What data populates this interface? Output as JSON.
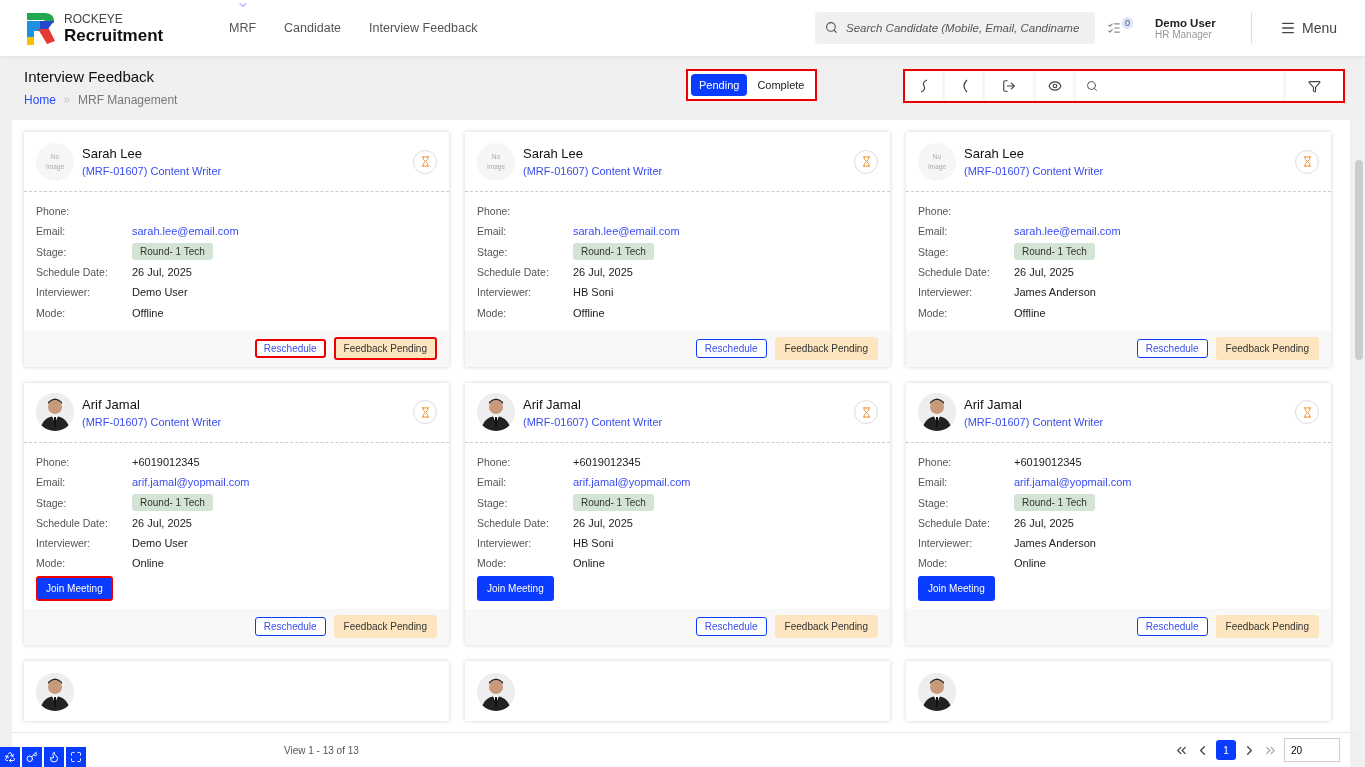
{
  "header": {
    "brand_top": "ROCKEYE",
    "brand": "Recruitment",
    "nav": [
      {
        "label": "MRF",
        "dropdown": true
      },
      {
        "label": "Candidate",
        "dropdown": false
      },
      {
        "label": "Interview Feedback",
        "dropdown": false
      }
    ],
    "search": {
      "placeholder": "Search Candidate (Mobile, Email, Candiname"
    },
    "notifications": "0",
    "user": {
      "name": "Demo User",
      "role": "HR Manager"
    },
    "menu": "Menu"
  },
  "page": {
    "title": "Interview Feedback",
    "breadcrumb": [
      "Home",
      "MRF Management"
    ],
    "status_tabs": [
      {
        "label": "Pending",
        "selected": true
      },
      {
        "label": "Complete",
        "selected": false
      }
    ],
    "tabs_annotated": true,
    "toolbar_annotated": true
  },
  "cards": [
    {
      "name": "Sarah Lee",
      "avatar": {
        "kind": "no-image",
        "text": "No Image"
      },
      "job": "(MRF-01607) Content Writer",
      "fields": [
        {
          "label": "Phone:",
          "kind": "text"
        },
        {
          "label": "Email:",
          "value": "sarah.lee@email.com",
          "kind": "link"
        },
        {
          "label": "Stage:",
          "value": "Round- 1 Tech",
          "kind": "badge"
        },
        {
          "label": "Schedule Date:",
          "value": "26 Jul, 2025",
          "kind": "text"
        },
        {
          "label": "Interviewer:",
          "value": "Demo User",
          "kind": "text"
        },
        {
          "label": "Mode:",
          "value": "Offline",
          "kind": "text"
        }
      ],
      "reschedule": "Reschedule",
      "status": "Feedback Pending",
      "annotated": true
    },
    {
      "name": "Sarah Lee",
      "avatar": {
        "kind": "no-image",
        "text": "No Image"
      },
      "job": "(MRF-01607) Content Writer",
      "fields": [
        {
          "label": "Phone:",
          "kind": "text"
        },
        {
          "label": "Email:",
          "value": "sarah.lee@email.com",
          "kind": "link"
        },
        {
          "label": "Stage:",
          "value": "Round- 1 Tech",
          "kind": "badge"
        },
        {
          "label": "Schedule Date:",
          "value": "26 Jul, 2025",
          "kind": "text"
        },
        {
          "label": "Interviewer:",
          "value": "HB Soni",
          "kind": "text"
        },
        {
          "label": "Mode:",
          "value": "Offline",
          "kind": "text"
        }
      ],
      "reschedule": "Reschedule",
      "status": "Feedback Pending",
      "annotated": false
    },
    {
      "name": "Sarah Lee",
      "avatar": {
        "kind": "no-image",
        "text": "No Image"
      },
      "job": "(MRF-01607) Content Writer",
      "fields": [
        {
          "label": "Phone:",
          "kind": "text"
        },
        {
          "label": "Email:",
          "value": "sarah.lee@email.com",
          "kind": "link"
        },
        {
          "label": "Stage:",
          "value": "Round- 1 Tech",
          "kind": "badge"
        },
        {
          "label": "Schedule Date:",
          "value": "26 Jul, 2025",
          "kind": "text"
        },
        {
          "label": "Interviewer:",
          "value": "James Anderson",
          "kind": "text"
        },
        {
          "label": "Mode:",
          "value": "Offline",
          "kind": "text"
        }
      ],
      "reschedule": "Reschedule",
      "status": "Feedback Pending",
      "annotated": false
    },
    {
      "name": "Arif Jamal",
      "job": "(MRF-01607) Content Writer",
      "fields": [
        {
          "label": "Phone:",
          "value": "+6019012345",
          "kind": "text"
        },
        {
          "label": "Email:",
          "value": "arif.jamal@yopmail.com",
          "kind": "link"
        },
        {
          "label": "Stage:",
          "value": "Round- 1 Tech",
          "kind": "badge"
        },
        {
          "label": "Schedule Date:",
          "value": "26 Jul, 2025",
          "kind": "text"
        },
        {
          "label": "Interviewer:",
          "value": "Demo User",
          "kind": "text"
        },
        {
          "label": "Mode:",
          "value": "Online",
          "kind": "text"
        }
      ],
      "join": "Join Meeting",
      "join_annotated": true,
      "reschedule": "Reschedule",
      "status": "Feedback Pending",
      "annotated": false
    },
    {
      "name": "Arif Jamal",
      "job": "(MRF-01607) Content Writer",
      "fields": [
        {
          "label": "Phone:",
          "value": "+6019012345",
          "kind": "text"
        },
        {
          "label": "Email:",
          "value": "arif.jamal@yopmail.com",
          "kind": "link"
        },
        {
          "label": "Stage:",
          "value": "Round- 1 Tech",
          "kind": "badge"
        },
        {
          "label": "Schedule Date:",
          "value": "26 Jul, 2025",
          "kind": "text"
        },
        {
          "label": "Interviewer:",
          "value": "HB Soni",
          "kind": "text"
        },
        {
          "label": "Mode:",
          "value": "Online",
          "kind": "text"
        }
      ],
      "join": "Join Meeting",
      "join_annotated": false,
      "reschedule": "Reschedule",
      "status": "Feedback Pending",
      "annotated": false
    },
    {
      "name": "Arif Jamal",
      "job": "(MRF-01607) Content Writer",
      "fields": [
        {
          "label": "Phone:",
          "value": "+6019012345",
          "kind": "text"
        },
        {
          "label": "Email:",
          "value": "arif.jamal@yopmail.com",
          "kind": "link"
        },
        {
          "label": "Stage:",
          "value": "Round- 1 Tech",
          "kind": "badge"
        },
        {
          "label": "Schedule Date:",
          "value": "26 Jul, 2025",
          "kind": "text"
        },
        {
          "label": "Interviewer:",
          "value": "James Anderson",
          "kind": "text"
        },
        {
          "label": "Mode:",
          "value": "Online",
          "kind": "text"
        }
      ],
      "join": "Join Meeting",
      "join_annotated": false,
      "reschedule": "Reschedule",
      "status": "Feedback Pending",
      "annotated": false
    }
  ],
  "footer": {
    "view": "View 1 - 13 of 13",
    "pages": [
      {
        "label": "1",
        "selected": true
      }
    ],
    "page_size": "20"
  }
}
